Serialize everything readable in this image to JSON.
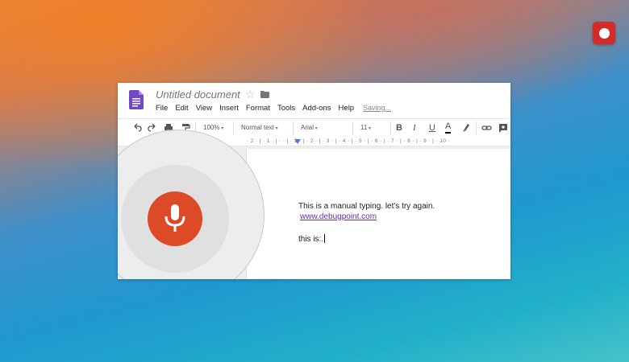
{
  "document": {
    "title": "Untitled document",
    "save_status": "Saving..."
  },
  "menu": [
    "File",
    "Edit",
    "View",
    "Insert",
    "Format",
    "Tools",
    "Add-ons",
    "Help"
  ],
  "toolbar": {
    "zoom": "100%",
    "style": "Normal text",
    "font": "Arial",
    "font_size": "11",
    "bold": "B",
    "italic": "I",
    "underline": "U",
    "text_color": "A"
  },
  "ruler": "· 2 · | · 1 · | · · | · 1 · | · 2 · | · 3 · | · 4 · | · 5 · | · 6 · | · 7 · | · 8 · | · 9 · | · 10 ·",
  "content": {
    "line1": "This is a manual typing.  let's try again.",
    "link": "www.debugpoint.com",
    "line3": "this is:."
  },
  "colors": {
    "mic_red": "#dc4a26",
    "record_red": "#d42a2a",
    "docs_purple": "#7248c7"
  },
  "icons": [
    "record-icon",
    "docs-logo-icon",
    "star-icon",
    "folder-icon",
    "undo-icon",
    "redo-icon",
    "print-icon",
    "paint-format-icon",
    "highlight-icon",
    "link-icon",
    "add-comment-icon",
    "microphone-icon"
  ]
}
